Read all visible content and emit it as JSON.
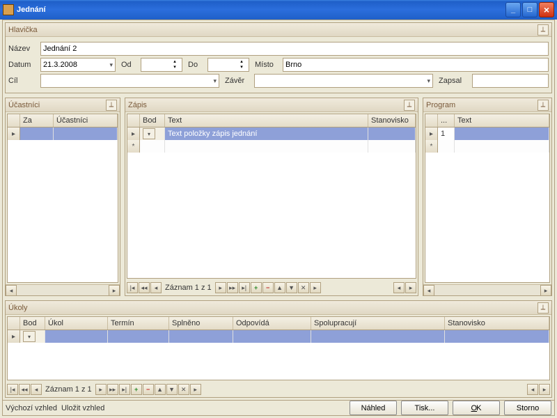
{
  "window": {
    "title": "Jednání"
  },
  "hlavicka": {
    "panel_title": "Hlavička",
    "nazev_label": "Název",
    "nazev_value": "Jednání 2",
    "datum_label": "Datum",
    "datum_value": "21.3.2008",
    "od_label": "Od",
    "od_value": "",
    "do_label": "Do",
    "do_value": "",
    "misto_label": "Místo",
    "misto_value": "Brno",
    "cil_label": "Cíl",
    "cil_value": "",
    "zaver_label": "Závěr",
    "zaver_value": "",
    "zapsal_label": "Zapsal",
    "zapsal_value": ""
  },
  "ucastnici": {
    "panel_title": "Účastníci",
    "cols": {
      "za": "Za",
      "ucastnici": "Účastníci"
    }
  },
  "zapis": {
    "panel_title": "Zápis",
    "cols": {
      "bod": "Bod",
      "text": "Text",
      "stanovisko": "Stanovisko"
    },
    "rows": [
      {
        "bod": "",
        "text": "Text položky zápis jednání",
        "stanovisko": ""
      }
    ],
    "nav_label": "Záznam 1 z 1"
  },
  "program": {
    "panel_title": "Program",
    "cols": {
      "num": "...",
      "text": "Text"
    },
    "rows": [
      {
        "num": "1",
        "text": ""
      }
    ]
  },
  "ukoly": {
    "panel_title": "Úkoly",
    "cols": {
      "bod": "Bod",
      "ukol": "Úkol",
      "termin": "Termín",
      "splneno": "Splněno",
      "odpovida": "Odpovídá",
      "spolupracuji": "Spolupracují",
      "stanovisko": "Stanovisko"
    },
    "nav_label": "Záznam 1 z 1"
  },
  "status": {
    "vychozi_vzhled": "Výchozí vzhled",
    "ulozit_vzhled": "Uložit vzhled"
  },
  "buttons": {
    "nahled": "Náhled",
    "tisk": "Tisk...",
    "ok": "OK",
    "storno": "Storno"
  },
  "nav_icons": {
    "add": "+",
    "remove": "−",
    "up": "▲",
    "down": "▼",
    "cancel": "✕"
  }
}
